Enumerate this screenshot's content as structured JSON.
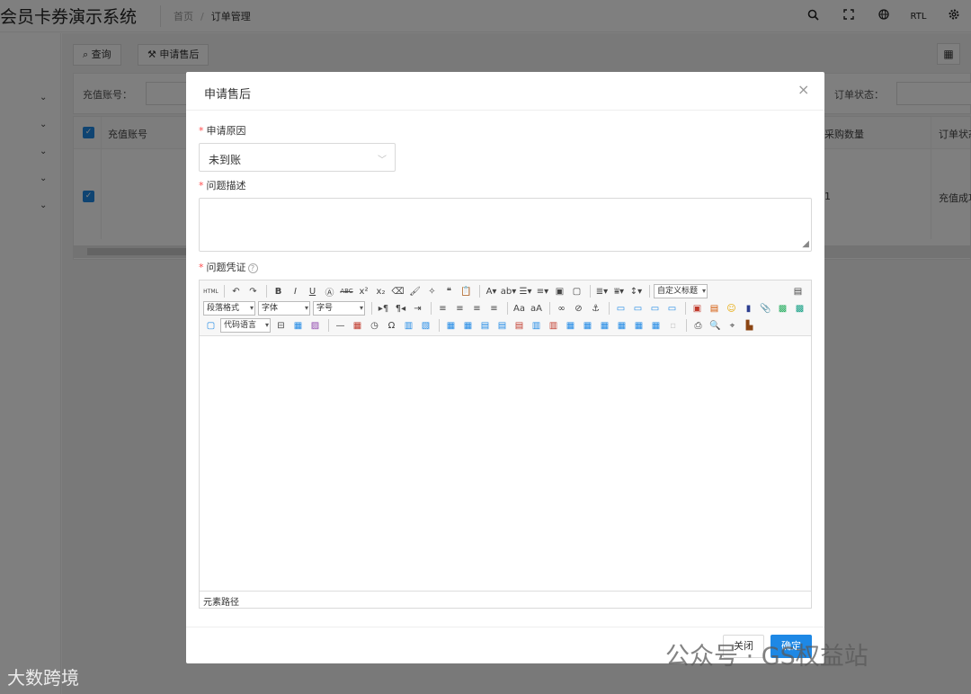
{
  "app": {
    "title": "会员卡券演示系统"
  },
  "breadcrumb": {
    "home": "首页",
    "separator": "/",
    "current": "订单管理"
  },
  "topbar": {
    "rtl_label": "RTL"
  },
  "sidebar": {
    "items": [
      "⌄",
      "⌄",
      "⌄",
      "⌄",
      "⌄"
    ]
  },
  "toolbar_bg": {
    "query_label": "查询",
    "after_sale_label": "申请售后"
  },
  "search": {
    "recharge_account_label": "充值账号：",
    "order_status_label": "订单状态："
  },
  "table": {
    "headers": [
      "充值账号",
      "采购数量",
      "订单状态"
    ],
    "row": {
      "quantity": "1",
      "status": "充值成功"
    }
  },
  "dialog": {
    "title": "申请售后",
    "close_glyph": "×",
    "reason_label": "申请原因",
    "reason_value": "未到账",
    "description_label": "问题描述",
    "evidence_label": "问题凭证",
    "required_mark": "*",
    "editor": {
      "html_label": "HTML",
      "custom_title": "自定义标题",
      "paragraph_format": "段落格式",
      "font_family": "字体",
      "font_size": "字号",
      "code_language": "代码语言",
      "status_path": "元素路径"
    },
    "cancel_label": "关闭",
    "confirm_label": "确定"
  },
  "watermarks": {
    "left": "大数跨境",
    "right": "公众号 · GS权益站"
  },
  "colors": {
    "primary": "#1e88e5",
    "required": "#ff4d4f",
    "overlay": "rgba(0,0,0,0.5)"
  }
}
